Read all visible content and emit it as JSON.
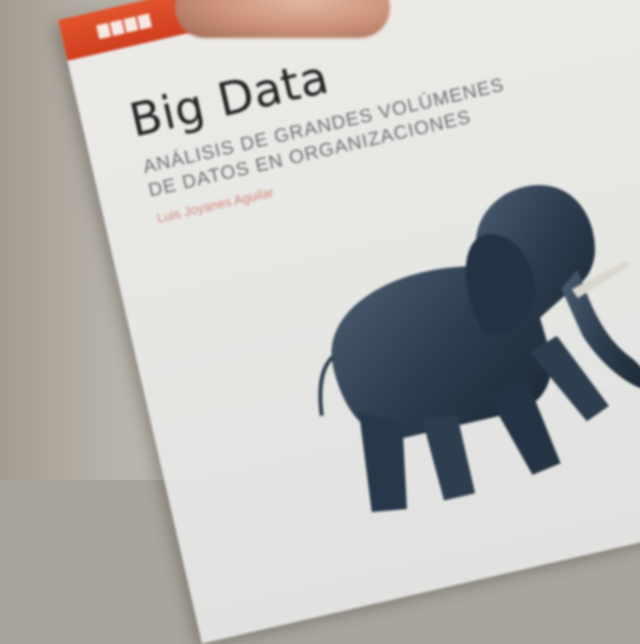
{
  "book": {
    "publisher_logo_letters": [
      "",
      "",
      "",
      ""
    ],
    "title": "Big Data",
    "subtitle_line1": "Análisis de grandes volúmenes",
    "subtitle_line2": "de datos en organizaciones",
    "author": "Luis Joyanes Aguilar"
  },
  "colors": {
    "band": "#d8482a",
    "cover": "#e8e8e5",
    "title": "#222222",
    "subtitle": "#6c6c70",
    "author": "#d48a80",
    "elephant": "#2d3e4f"
  }
}
